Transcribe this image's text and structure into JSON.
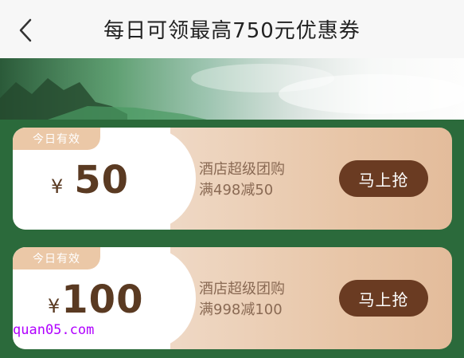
{
  "header": {
    "title": "每日可领最高750元优惠券"
  },
  "coupons": [
    {
      "tag": "今日有效",
      "currency": "¥",
      "amount": "50",
      "name": "酒店超级团购",
      "rule": "满498减50",
      "button": "马上抢"
    },
    {
      "tag": "今日有效",
      "currency": "¥",
      "amount": "100",
      "name": "酒店超级团购",
      "rule": "满998减100",
      "button": "马上抢"
    }
  ],
  "watermark": "quan05.com",
  "icons": {
    "back": "chevron-left-icon"
  },
  "colors": {
    "accent": "#6a3b22",
    "background": "#2b6a3b",
    "tag": "#ebc8a7"
  }
}
